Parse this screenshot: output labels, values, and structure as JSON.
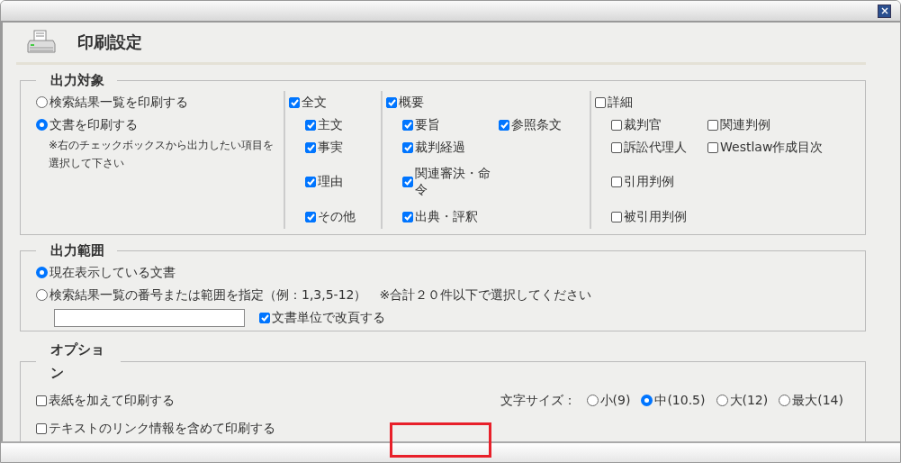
{
  "dialog": {
    "title": "印刷設定"
  },
  "target": {
    "legend": "出力対象",
    "modes": [
      {
        "label": "検索結果一覧を印刷する",
        "selected": false
      },
      {
        "label": "文書を印刷する",
        "selected": true
      }
    ],
    "note": "※右のチェックボックスから出力したい項目を選択して下さい",
    "groups": [
      {
        "label": "全文",
        "checked": true,
        "rows": [
          [
            {
              "label": "主文",
              "checked": true
            }
          ],
          [
            {
              "label": "事実",
              "checked": true
            }
          ],
          [
            {
              "label": "理由",
              "checked": true
            }
          ],
          [
            {
              "label": "その他",
              "checked": true
            }
          ]
        ]
      },
      {
        "label": "概要",
        "checked": true,
        "rows": [
          [
            {
              "label": "要旨",
              "checked": true
            },
            {
              "label": "参照条文",
              "checked": true
            }
          ],
          [
            {
              "label": "裁判経過",
              "checked": true
            }
          ],
          [
            {
              "label": "関連審決・命令",
              "checked": true
            }
          ],
          [
            {
              "label": "出典・評釈",
              "checked": true
            }
          ]
        ]
      },
      {
        "label": "詳細",
        "checked": false,
        "rows": [
          [
            {
              "label": "裁判官",
              "checked": false
            },
            {
              "label": "関連判例",
              "checked": false
            }
          ],
          [
            {
              "label": "訴訟代理人",
              "checked": false
            },
            {
              "label": "Westlaw作成目次",
              "checked": false
            }
          ],
          [
            {
              "label": "引用判例",
              "checked": false
            }
          ],
          [
            {
              "label": "被引用判例",
              "checked": false
            }
          ]
        ]
      }
    ]
  },
  "range": {
    "legend": "出力範囲",
    "modes": [
      {
        "label": "現在表示している文書",
        "selected": true
      },
      {
        "label": "検索結果一覧の番号または範囲を指定（例：1,3,5-12）",
        "selected": false
      }
    ],
    "hint": "※合計２０件以下で選択してください",
    "page_break": {
      "label": "文書単位で改頁する",
      "checked": true
    }
  },
  "options": {
    "legend": "オプション",
    "items": [
      {
        "label": "表紙を加えて印刷する",
        "checked": false
      },
      {
        "label": "テキストのリンク情報を含めて印刷する",
        "checked": false
      }
    ],
    "font_size": {
      "label": "文字サイズ：",
      "choices": [
        {
          "label": "小(9)",
          "selected": false
        },
        {
          "label": "中(10.5)",
          "selected": true
        },
        {
          "label": "大(12)",
          "selected": false
        },
        {
          "label": "最大(14)",
          "selected": false
        }
      ]
    }
  }
}
